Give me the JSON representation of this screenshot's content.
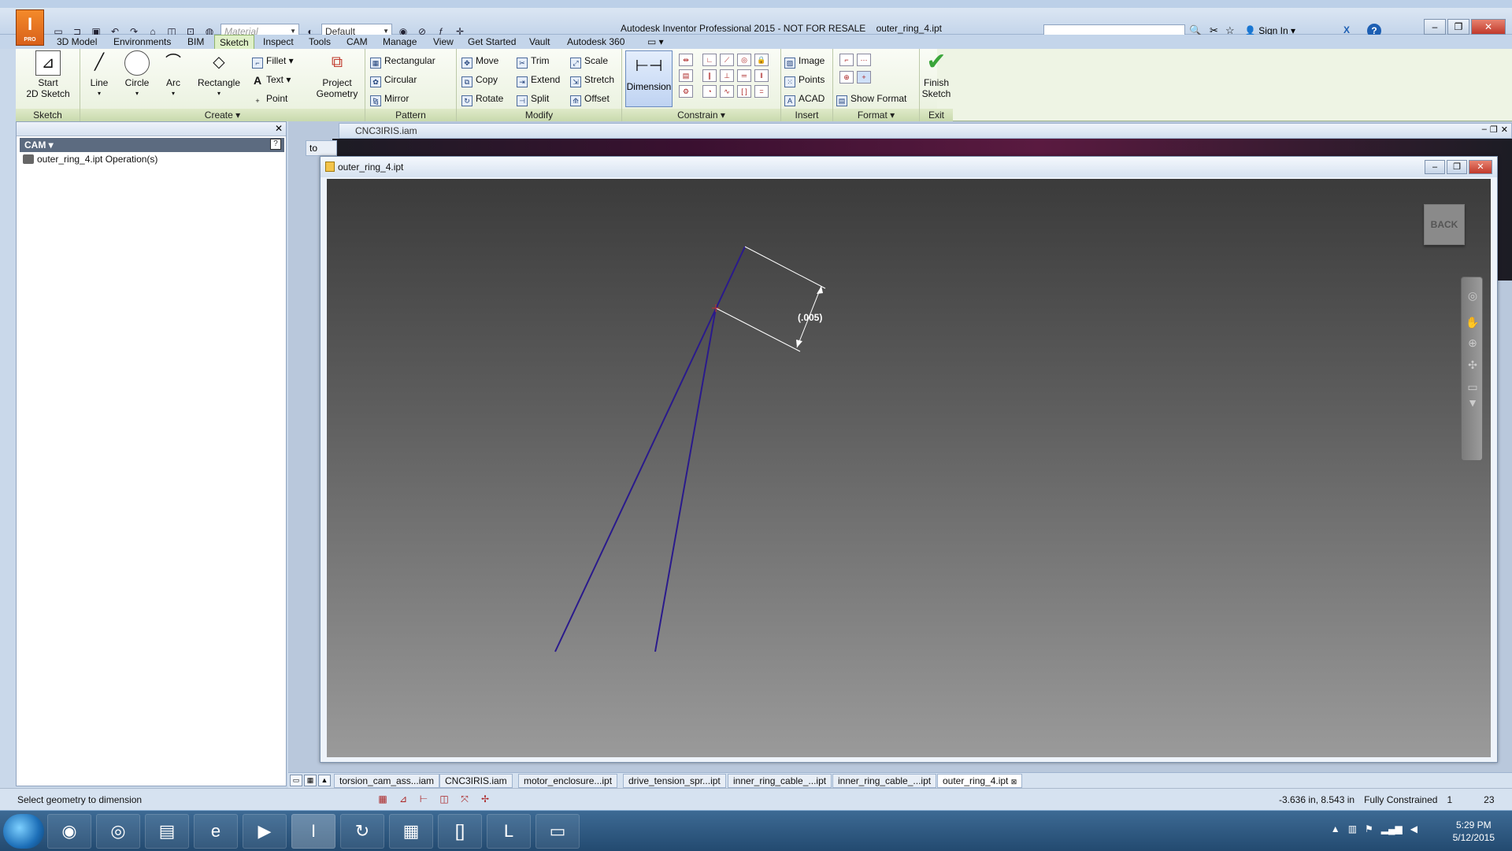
{
  "app": {
    "title": "Autodesk Inventor Professional 2015 - NOT FOR RESALE",
    "document": "outer_ring_4.ipt",
    "logo_letter": "I",
    "logo_sub": "PRO",
    "sign_in": "Sign In"
  },
  "qat": {
    "material_placeholder": "Material",
    "appearance_value": "Default"
  },
  "menu_tabs": [
    "3D Model",
    "Environments",
    "BIM",
    "Sketch",
    "Inspect",
    "Tools",
    "CAM",
    "Manage",
    "View",
    "Get Started",
    "Vault",
    "Autodesk 360"
  ],
  "active_tab": "Sketch",
  "ribbon": {
    "sketch": {
      "label": "Sketch",
      "start_line1": "Start",
      "start_line2": "2D Sketch"
    },
    "create": {
      "label": "Create",
      "line": "Line",
      "circle": "Circle",
      "arc": "Arc",
      "rectangle": "Rectangle",
      "fillet": "Fillet",
      "text": "Text",
      "point": "Point",
      "project_line1": "Project",
      "project_line2": "Geometry"
    },
    "pattern": {
      "label": "Pattern",
      "rectangular": "Rectangular",
      "circular": "Circular",
      "mirror": "Mirror"
    },
    "modify": {
      "label": "Modify",
      "move": "Move",
      "copy": "Copy",
      "rotate": "Rotate",
      "trim": "Trim",
      "extend": "Extend",
      "split": "Split",
      "scale": "Scale",
      "stretch": "Stretch",
      "offset": "Offset"
    },
    "constrain": {
      "label": "Constrain",
      "dimension": "Dimension"
    },
    "insert": {
      "label": "Insert",
      "image": "Image",
      "points": "Points",
      "acad": "ACAD"
    },
    "format": {
      "label": "Format",
      "show_format": "Show Format"
    },
    "exit": {
      "label": "Exit",
      "finish_line1": "Finish",
      "finish_line2": "Sketch"
    }
  },
  "browser": {
    "header": "CAM",
    "tree_item": "outer_ring_4.ipt Operation(s)"
  },
  "workspace": {
    "assembly_title": "CNC3IRIS.iam",
    "hidden_tab": "to",
    "part_title": "outer_ring_4.ipt",
    "back_label": "BACK",
    "dimension_value": "(.005)"
  },
  "doc_tabs": [
    "torsion_cam_ass...iam",
    "CNC3IRIS.iam",
    "motor_enclosure...ipt",
    "drive_tension_spr...ipt",
    "inner_ring_cable_...ipt",
    "inner_ring_cable_...ipt",
    "outer_ring_4.ipt"
  ],
  "active_doc_tab": "outer_ring_4.ipt",
  "status": {
    "message": "Select geometry to dimension",
    "coords": "-3.636 in, 8.543 in",
    "constraint": "Fully Constrained",
    "count1": "1",
    "count2": "23"
  },
  "clock": {
    "time": "5:29 PM",
    "date": "5/12/2015"
  },
  "colors": {
    "sketch_line": "#2a1a8c",
    "ribbon_accent": "#dff0c8",
    "finish_check": "#3aa53a"
  }
}
